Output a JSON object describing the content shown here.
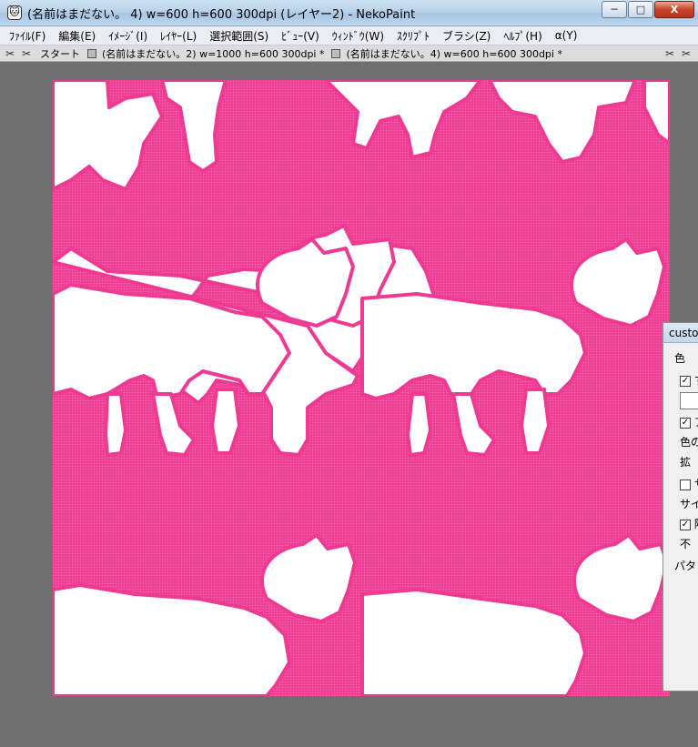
{
  "window": {
    "title": "(名前はまだない。 4) w=600 h=600 300dpi  (レイヤー2) - NekoPaint",
    "app_icon": "cat-icon",
    "minimize": "─",
    "maximize": "□",
    "close": "X"
  },
  "menu": {
    "items": [
      "ﾌｧｲﾙ(F)",
      "編集(E)",
      "ｲﾒｰｼﾞ(I)",
      "ﾚｲﾔｰ(L)",
      "選択範囲(S)",
      "ﾋﾞｭｰ(V)",
      "ｳｨﾝﾄﾞｳ(W)",
      "ｽｸﾘﾌﾟﾄ",
      "ブラシ(Z)",
      "ﾍﾙﾌﾟ(H)",
      "α(Y)"
    ]
  },
  "tabs": {
    "start": "スタート",
    "doc1": "(名前はまだない。2) w=1000 h=600 300dpi *",
    "doc2": "(名前はまだない。4) w=600 h=600 300dpi *"
  },
  "panel": {
    "title": "custo",
    "tab_label": "色",
    "row1": "す",
    "row2": "ア",
    "row3": "色の",
    "row4": "拡",
    "row5": "サ",
    "row6": "サイ",
    "row7": "隣",
    "row8": "不",
    "row9": "パタ"
  },
  "colors": {
    "canvas_pink": "#ee3a92",
    "cat_outline": "#ee3a92",
    "cat_fill": "#ffffff"
  }
}
